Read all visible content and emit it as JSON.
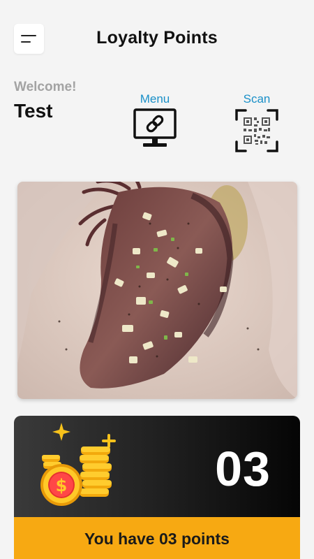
{
  "header": {
    "title": "Loyalty Points",
    "menu_icon": "hamburger-menu-icon"
  },
  "welcome": {
    "label": "Welcome!",
    "name": "Test"
  },
  "actions": {
    "menu": {
      "label": "Menu",
      "icon": "monitor-link-icon"
    },
    "scan": {
      "label": "Scan",
      "icon": "qr-scan-icon"
    }
  },
  "promo_image": {
    "subject": "grilled-squid-with-onions-image"
  },
  "points": {
    "value": "03",
    "message": "You have 03 points",
    "icon": "coin-stack-icon"
  },
  "colors": {
    "background": "#f4f4f4",
    "accent_blue": "#1a90c8",
    "points_footer": "#f7a912",
    "card_dark": "#1e1e1e"
  }
}
